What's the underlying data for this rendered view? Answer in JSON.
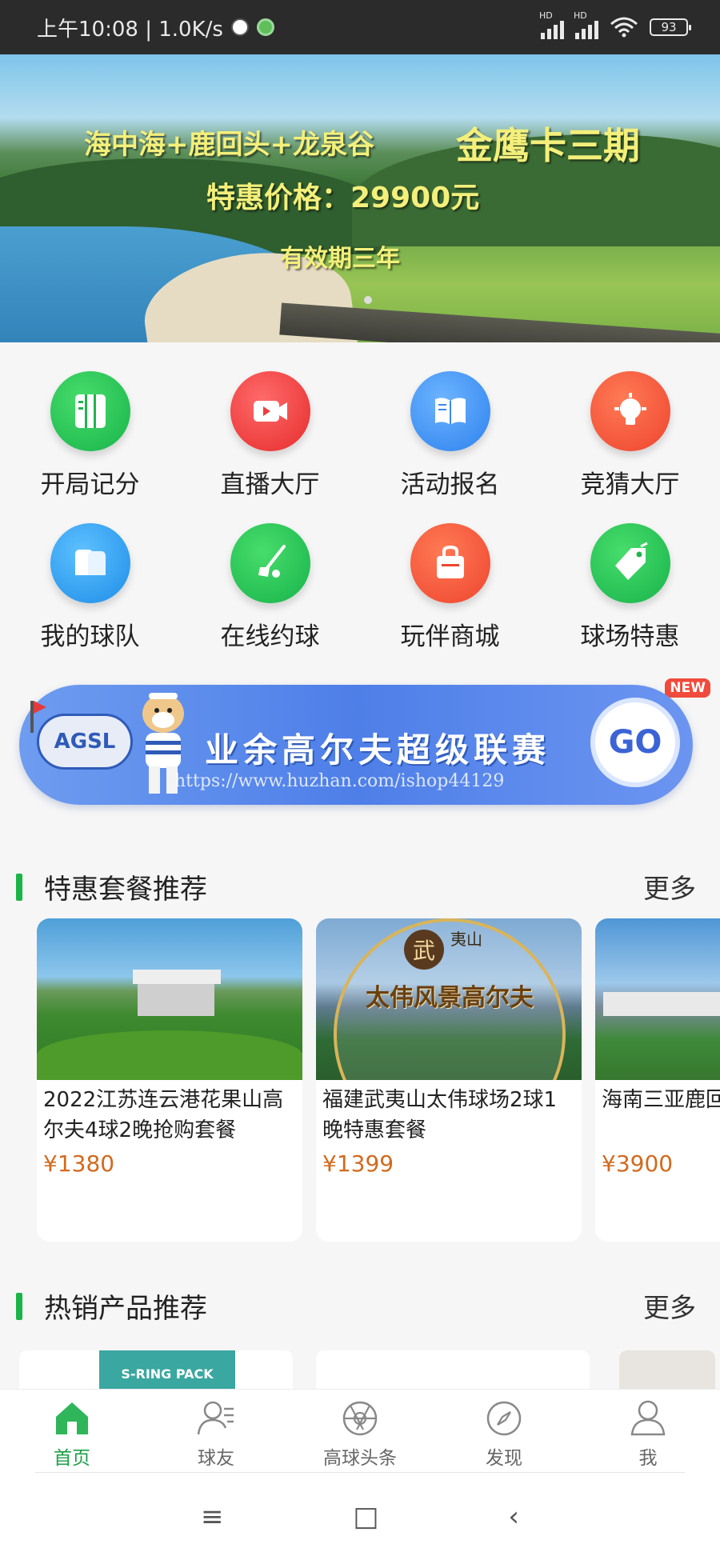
{
  "status_bar": {
    "time": "上午10:08 | 1.0K/s",
    "signal_label": "HD",
    "battery": "93"
  },
  "banner": {
    "line1": "海中海+鹿回头+龙泉谷",
    "line1_highlight": "金鹰卡三期",
    "line2": "特惠价格：29900元",
    "line3": "有效期三年"
  },
  "grid": {
    "items": [
      {
        "label": "开局记分",
        "icon": "scorecard-icon"
      },
      {
        "label": "直播大厅",
        "icon": "video-camera-icon"
      },
      {
        "label": "活动报名",
        "icon": "book-icon"
      },
      {
        "label": "竞猜大厅",
        "icon": "lightbulb-icon"
      },
      {
        "label": "我的球队",
        "icon": "team-icon"
      },
      {
        "label": "在线约球",
        "icon": "golf-club-icon"
      },
      {
        "label": "玩伴商城",
        "icon": "shopping-bag-icon"
      },
      {
        "label": "球场特惠",
        "icon": "tag-icon"
      }
    ],
    "new_badge": "NEW"
  },
  "league": {
    "logo_text": "AGSL",
    "title": "业余高尔夫超级联赛",
    "go": "GO",
    "watermark": "https://www.huzhan.com/ishop44129"
  },
  "section_deals": {
    "title": "特惠套餐推荐",
    "more": "更多",
    "cards": [
      {
        "name": "2022江苏连云港花果山高尔夫4球2晚抢购套餐",
        "price": "¥1380"
      },
      {
        "name": "福建武夷山太伟球场2球1晚特惠套餐",
        "price": "¥1399",
        "overlay_top": "武",
        "overlay_top2": "夷山",
        "overlay_main": "太伟风景高尔夫"
      },
      {
        "name": "海南三亚鹿回头龙泉谷超值",
        "price": "¥3900"
      }
    ]
  },
  "section_hot": {
    "title": "热销产品推荐",
    "more": "更多",
    "product_label": "S-RING PACK"
  },
  "tabbar": {
    "tabs": [
      {
        "label": "首页",
        "icon": "home-icon"
      },
      {
        "label": "球友",
        "icon": "friends-icon"
      },
      {
        "label": "高球头条",
        "icon": "aperture-icon"
      },
      {
        "label": "发现",
        "icon": "compass-icon"
      },
      {
        "label": "我",
        "icon": "profile-icon"
      }
    ]
  },
  "system_nav": {
    "menu": "≡",
    "home": "□",
    "back": "‹"
  },
  "colors": {
    "accent_green": "#1cb448",
    "price_orange": "#d26a1e",
    "league_blue": "#4e7fe8"
  }
}
